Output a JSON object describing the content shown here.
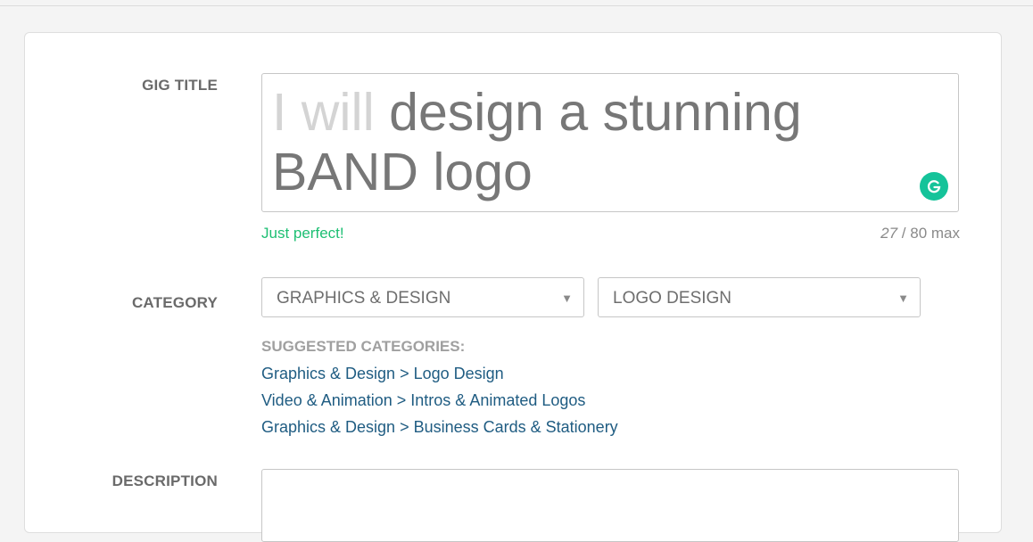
{
  "form": {
    "gig_title": {
      "label": "GIG TITLE",
      "prefix": "I will",
      "value": "design a stunning BAND logo",
      "status": "Just perfect!",
      "count": "27",
      "max": "/ 80 max"
    },
    "category": {
      "label": "CATEGORY",
      "primary": "GRAPHICS & DESIGN",
      "secondary": "LOGO DESIGN",
      "suggested_title": "SUGGESTED CATEGORIES:",
      "suggestions": [
        "Graphics & Design > Logo Design",
        "Video & Animation > Intros & Animated Logos",
        "Graphics & Design > Business Cards & Stationery"
      ]
    },
    "description": {
      "label": "DESCRIPTION",
      "value": ""
    }
  },
  "icons": {
    "grammarly": "grammarly-icon",
    "caret": "caret-down-icon"
  },
  "colors": {
    "success": "#1dbf73",
    "link": "#1f5c82",
    "grammarly": "#15c39a"
  }
}
